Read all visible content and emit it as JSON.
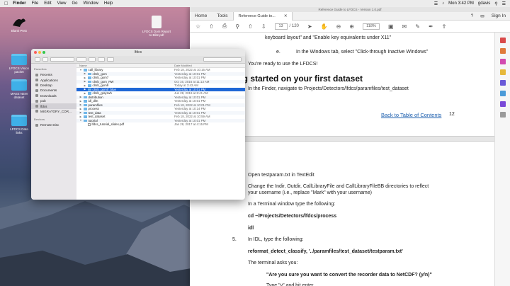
{
  "menubar": {
    "items": [
      "Finder",
      "File",
      "Edit",
      "View",
      "Go",
      "Window",
      "Help"
    ],
    "right": "Mon 3:42 PM",
    "user": "gdavis"
  },
  "desktop": {
    "icons": [
      {
        "label": "Blank PNG"
      },
      {
        "label": "LFDCS Dom Report\nto Blitz.pdf"
      },
      {
        "label": "LFDCS Vision\npacket"
      },
      {
        "label": "MAKE NEW\ndataset"
      },
      {
        "label": "LFDCS Data\nlinks"
      }
    ]
  },
  "finder": {
    "title": "lfdcs",
    "sidebar": {
      "favorites_header": "Favorites",
      "favorites": [
        "Recents",
        "Applications",
        "Desktop",
        "Documents",
        "Downloads",
        "pub",
        "lfdcs",
        "MIGRATORY_COR..."
      ],
      "devices_header": "Devices",
      "devices": [
        "Remote Disc"
      ]
    },
    "columns": {
      "name": "Name",
      "date": "Date Modified"
    },
    "rows": [
      {
        "name": "call_library",
        "date": "Feb 18, 2022 at 10:16 AM",
        "level": 0,
        "open": true,
        "kind": "folder"
      },
      {
        "name": "clmb_gom",
        "date": "Yesterday at 10:01 PM",
        "level": 1,
        "open": false,
        "kind": "folder"
      },
      {
        "name": "clmb_gom7",
        "date": "Yesterday at 10:01 PM",
        "level": 1,
        "open": false,
        "kind": "folder"
      },
      {
        "name": "clmb_gom_RW",
        "date": "Oct 16, 2016 at 11:13 AM",
        "level": 1,
        "open": false,
        "kind": "folder"
      },
      {
        "name": "clmb_gom9",
        "date": "Today at 3:43 AM",
        "level": 1,
        "open": false,
        "kind": "folder"
      },
      {
        "name": "clmb_gomtf_blue",
        "date": "Yesterday at 10:01 PM",
        "level": 1,
        "open": false,
        "kind": "folder",
        "selected": true
      },
      {
        "name": "clmb_grayrwh",
        "date": "Jun 28, 2019 at 8:41 AM",
        "level": 1,
        "open": false,
        "kind": "folder"
      },
      {
        "name": "distribution",
        "date": "Yesterday at 10:01 PM",
        "level": 0,
        "open": false,
        "kind": "folder"
      },
      {
        "name": "idl_dlm",
        "date": "Yesterday at 10:01 PM",
        "level": 0,
        "open": false,
        "kind": "folder"
      },
      {
        "name": "paramfiles",
        "date": "Feb 18, 2022 at 10:01 PM",
        "level": 0,
        "open": false,
        "kind": "folder"
      },
      {
        "name": "process",
        "date": "Yesterday at 10:14 PM",
        "level": 0,
        "open": false,
        "kind": "folder"
      },
      {
        "name": "test_data",
        "date": "Yesterday at 10:01 PM",
        "level": 0,
        "open": false,
        "kind": "folder"
      },
      {
        "name": "test_dataset",
        "date": "Feb 18, 2022 at 10:59 AM",
        "level": 0,
        "open": false,
        "kind": "folder"
      },
      {
        "name": "tutorial",
        "date": "Yesterday at 10:01 PM",
        "level": 0,
        "open": true,
        "kind": "folder"
      },
      {
        "name": "lfdcs_tutorial_slides.pdf",
        "date": "Jan 28, 2017 at 4:15 PM",
        "level": 1,
        "open": false,
        "kind": "pdf"
      }
    ]
  },
  "reader": {
    "window_title": "Reference Guide to LFDCS - Version 1.0.pdf",
    "tabs": {
      "home": "Home",
      "tools": "Tools",
      "doc": "Reference Guide to..."
    },
    "signin": "Sign In",
    "page_current": "13",
    "page_total": "/ 120",
    "zoom": "118%",
    "page_top": {
      "line1": "keyboard layout\" and \"Enable key equivalents under X11\"",
      "item_e": "e.",
      "line_e": "In the Windows tab, select \"Click-through Inactive Windows\"",
      "ready": "You're ready to use the LFDCS!",
      "heading": "ting started on your first dataset",
      "finder_text": "In the Finder, navigate to Projects/Detectors/lfdcs/paramfiles/test_dataset",
      "back_link": "Back to Table of Contents",
      "page_no": "12"
    },
    "page_bottom": {
      "open": "Open testparam.txt in TextEdit",
      "change1": "Change the Indir, Outdir, CallLibraryFile and CallLibraryFileBB directories to reflect",
      "change2": "your username (i.e., replace \"Mark\" with your username)",
      "terminal": "In a Terminal window type the following:",
      "cd": "cd ~/Projects/Detectors/lfdcs/process",
      "idl": "idl",
      "step5_num": "5.",
      "step5": "In IDL, type the following:",
      "reformat": "reformat_detect_classify, '../paramfiles/test_dataset/testparam.txt'",
      "asks": "The terminal asks you:",
      "question": "\"Are you sure you want to convert the recorder data to NetCDF? (y/n)\"",
      "type": "Type \"y\" and hit enter"
    }
  },
  "colors": {
    "selection": "#1f67d6",
    "folder": "#6fb6e8",
    "link": "#1a5dad"
  }
}
